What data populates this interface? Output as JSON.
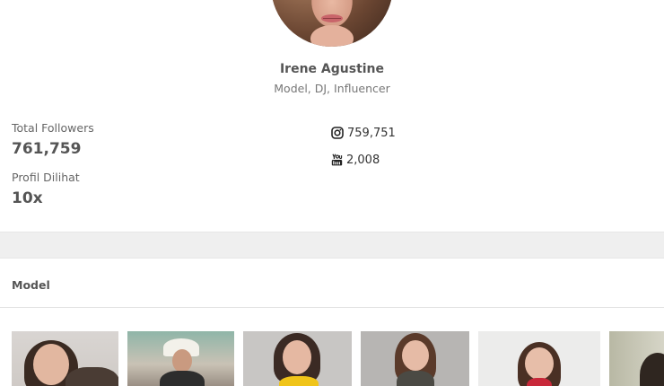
{
  "profile": {
    "name": "Irene Agustine",
    "role": "Model, DJ, Influencer"
  },
  "stats": {
    "followers_label": "Total Followers",
    "followers_value": "761,759",
    "views_label": "Profil Dilihat",
    "views_value": "10x"
  },
  "social": {
    "instagram": {
      "icon": "instagram-icon",
      "count": "759,751"
    },
    "youtube": {
      "icon": "youtube-icon",
      "count": "2,008"
    }
  },
  "gallery": {
    "title": "Model",
    "photos": [
      "model-photo-1",
      "model-photo-2",
      "model-photo-3",
      "model-photo-4",
      "model-photo-5",
      "model-photo-6"
    ]
  }
}
